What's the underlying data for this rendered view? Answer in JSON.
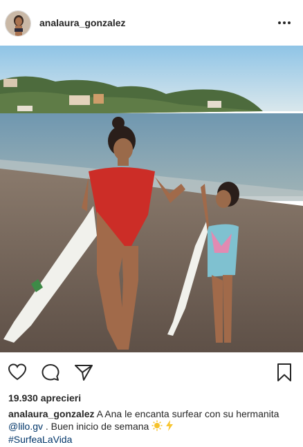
{
  "post": {
    "username": "analaura_gonzalez",
    "likes_text": "19.930 aprecieri",
    "caption": {
      "username": "analaura_gonzalez",
      "text_part1": " A Ana le encanta surfear con su hermanita ",
      "mention": "@lilo.gv",
      "text_part2": " . Buen inicio de semana ",
      "hashtag": "#SurfeaLaVida"
    }
  },
  "icons": {
    "more": "more-options-icon",
    "like": "heart-icon",
    "comment": "comment-icon",
    "share": "send-icon",
    "save": "bookmark-icon",
    "emoji1": "sun-emoji",
    "emoji2": "lightning-emoji"
  },
  "colors": {
    "text": "#262626",
    "link": "#003569",
    "border": "#dbdbdb"
  }
}
